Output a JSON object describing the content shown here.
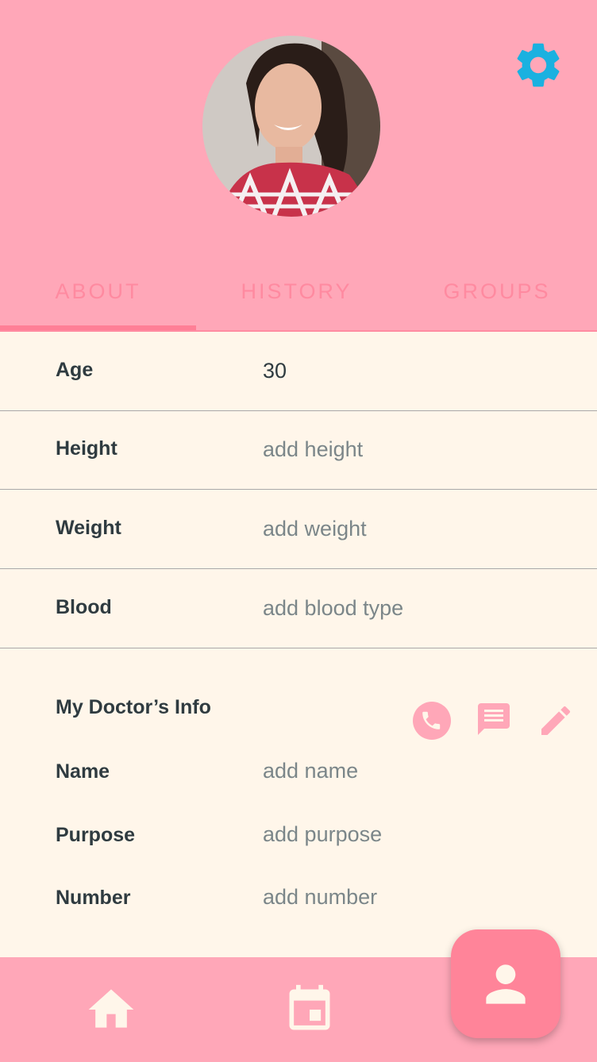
{
  "profile": {
    "avatar_alt": "profile photo"
  },
  "tabs": [
    {
      "label": "ABOUT"
    },
    {
      "label": "HISTORY"
    },
    {
      "label": "GROUPS"
    }
  ],
  "about": [
    {
      "label": "Age",
      "value": "30"
    },
    {
      "label": "Height",
      "value": "add height"
    },
    {
      "label": "Weight",
      "value": "add weight"
    },
    {
      "label": "Blood",
      "value": "add blood type"
    }
  ],
  "doctor": {
    "title": "My Doctor’s Info",
    "fields": [
      {
        "label": "Name",
        "value": "add name"
      },
      {
        "label": "Purpose",
        "value": "add purpose"
      },
      {
        "label": "Number",
        "value": "add number"
      }
    ]
  },
  "icons": {
    "settings": "gear-icon",
    "phone": "phone-icon",
    "message": "message-icon",
    "edit": "pencil-icon",
    "home": "home-icon",
    "calendar": "calendar-icon",
    "profile": "person-icon"
  },
  "colors": {
    "header": "#ffa7b8",
    "accent": "#ff8499",
    "gear": "#1ab1e0",
    "background": "#fff6ea"
  }
}
